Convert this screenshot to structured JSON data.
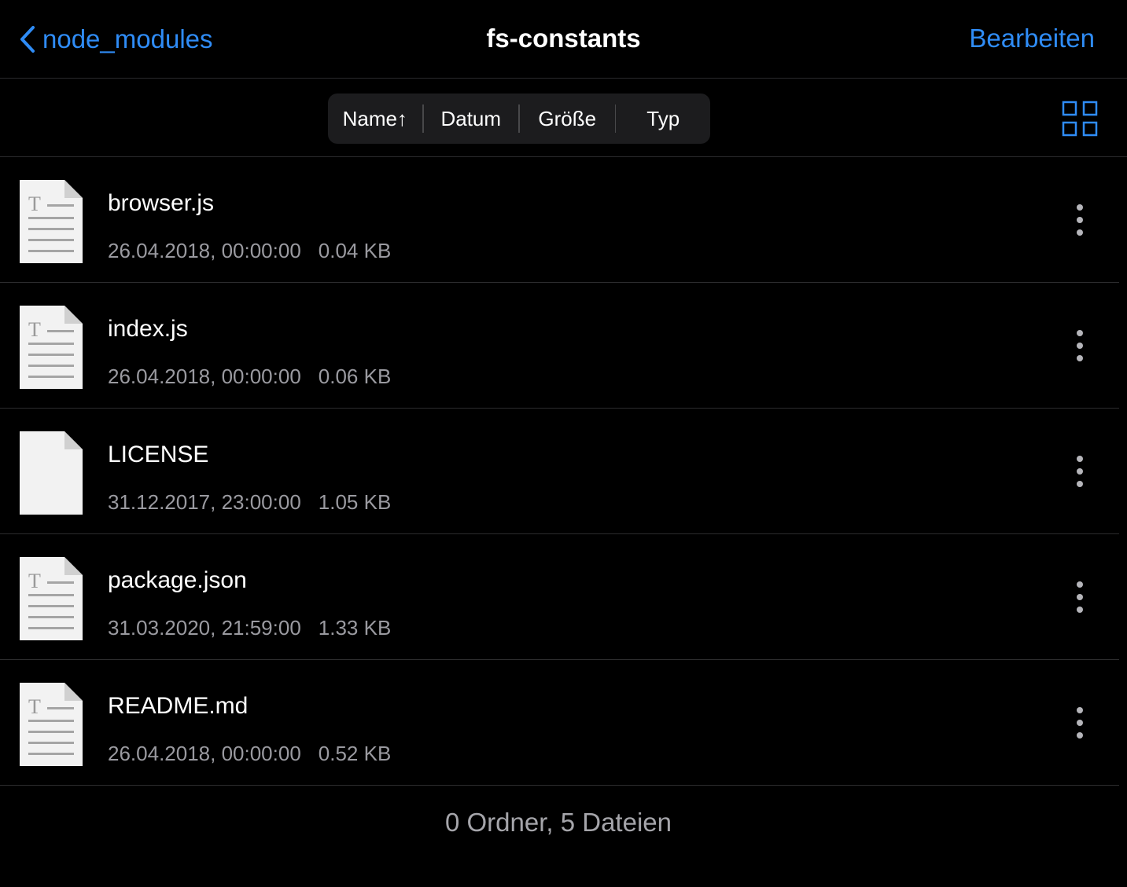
{
  "nav": {
    "back_label": "node_modules",
    "title": "fs-constants",
    "edit_label": "Bearbeiten"
  },
  "sort": {
    "segments": [
      "Name↑",
      "Datum",
      "Größe",
      "Typ"
    ],
    "selected": "Name"
  },
  "colors": {
    "accent": "#2f8cf6",
    "background": "#000000",
    "secondary_text": "#9a9aa0"
  },
  "files": [
    {
      "name": "browser.js",
      "date": "26.04.2018, 00:00:00",
      "size": "0.04 KB",
      "icon": "text-document-icon"
    },
    {
      "name": "index.js",
      "date": "26.04.2018, 00:00:00",
      "size": "0.06 KB",
      "icon": "text-document-icon"
    },
    {
      "name": "LICENSE",
      "date": "31.12.2017, 23:00:00",
      "size": "1.05 KB",
      "icon": "blank-document-icon"
    },
    {
      "name": "package.json",
      "date": "31.03.2020, 21:59:00",
      "size": "1.33 KB",
      "icon": "text-document-icon"
    },
    {
      "name": "README.md",
      "date": "26.04.2018, 00:00:00",
      "size": "0.52 KB",
      "icon": "text-document-icon"
    }
  ],
  "footer": {
    "summary": "0 Ordner, 5 Dateien"
  }
}
